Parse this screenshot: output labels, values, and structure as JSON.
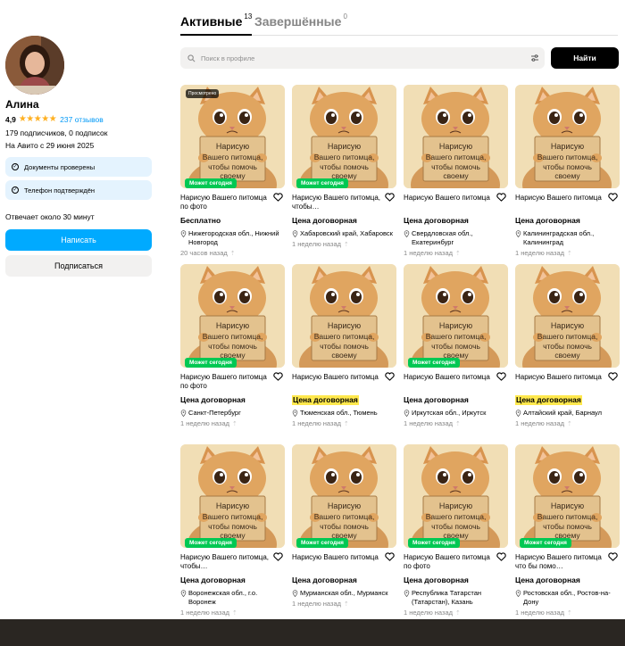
{
  "profile": {
    "name": "Алина",
    "rating": "4,9",
    "stars": "★★★★★",
    "reviews": "237 отзывов",
    "followers": "179 подписчиков, 0 подписок",
    "since": "На Авито с 29 июня 2025",
    "verified_docs": "Документы проверены",
    "verified_phone": "Телефон подтверждён",
    "response": "Отвечает около 30 минут",
    "write_button": "Написать",
    "subscribe_button": "Подписаться"
  },
  "tabs": {
    "active_label": "Активные",
    "active_count": "13",
    "done_label": "Завершённые",
    "done_count": "0"
  },
  "search": {
    "placeholder": "Поиск в профиле",
    "button": "Найти"
  },
  "listings": {
    "viewed_badge": "Просмотрено",
    "today_badge": "Может сегодня",
    "thumb_text": [
      "Нарисую",
      "Вашего питомца,",
      "чтобы помочь",
      "своему"
    ],
    "items": [
      {
        "title": "Нарисую Вашего питомца по фото",
        "price": "Бесплатно",
        "location": "Нижегородская обл., Нижний Новгород",
        "time": "20 часов назад",
        "today": true,
        "viewed": true,
        "highlight": false
      },
      {
        "title": "Нарисую Вашего питомца, чтобы…",
        "price": "Цена договорная",
        "location": "Хабаровский край, Хабаровск",
        "time": "1 неделю назад",
        "today": true,
        "viewed": false,
        "highlight": false
      },
      {
        "title": "Нарисую Вашего питомца",
        "price": "Цена договорная",
        "location": "Свердловская обл., Екатеринбург",
        "time": "1 неделю назад",
        "today": false,
        "viewed": false,
        "highlight": false
      },
      {
        "title": "Нарисую Вашего питомца",
        "price": "Цена договорная",
        "location": "Калининградская обл., Калининград",
        "time": "1 неделю назад",
        "today": false,
        "viewed": false,
        "highlight": false
      },
      {
        "title": "Нарисую Вашего питомца по фото",
        "price": "Цена договорная",
        "location": "Санкт-Петербург",
        "time": "1 неделю назад",
        "today": true,
        "viewed": false,
        "highlight": false
      },
      {
        "title": "Нарисую Вашего питомца",
        "price": "Цена договорная",
        "location": "Тюменская обл., Тюмень",
        "time": "1 неделю назад",
        "today": false,
        "viewed": false,
        "highlight": true
      },
      {
        "title": "Нарисую Вашего питомца",
        "price": "Цена договорная",
        "location": "Иркутская обл., Иркутск",
        "time": "1 неделю назад",
        "today": true,
        "viewed": false,
        "highlight": false
      },
      {
        "title": "Нарисую Вашего питомца",
        "price": "Цена договорная",
        "location": "Алтайский край, Барнаул",
        "time": "1 неделю назад",
        "today": false,
        "viewed": false,
        "highlight": true
      },
      {
        "title": "Нарисую Вашего питомца, чтобы…",
        "price": "Цена договорная",
        "location": "Воронежская обл., г.о. Воронеж",
        "time": "1 неделю назад",
        "today": true,
        "viewed": false,
        "highlight": false
      },
      {
        "title": "Нарисую Вашего питомца",
        "price": "Цена договорная",
        "location": "Мурманская обл., Мурманск",
        "time": "1 неделю назад",
        "today": true,
        "viewed": false,
        "highlight": false
      },
      {
        "title": "Нарисую Вашего питомца по фото",
        "price": "Цена договорная",
        "location": "Республика Татарстан (Татарстан), Казань",
        "time": "1 неделю назад",
        "today": true,
        "viewed": false,
        "highlight": false
      },
      {
        "title": "Нарисую Вашего питомца что бы помо…",
        "price": "Цена договорная",
        "location": "Ростовская обл., Ростов-на-Дону",
        "time": "1 неделю назад",
        "today": true,
        "viewed": false,
        "highlight": false
      }
    ]
  },
  "colors": {
    "accent_blue": "#00aaff",
    "badge_green": "#00c853",
    "verify_bg": "#e4f3fe",
    "highlight_yellow": "#ffe84d",
    "star_yellow": "#ffb021"
  }
}
